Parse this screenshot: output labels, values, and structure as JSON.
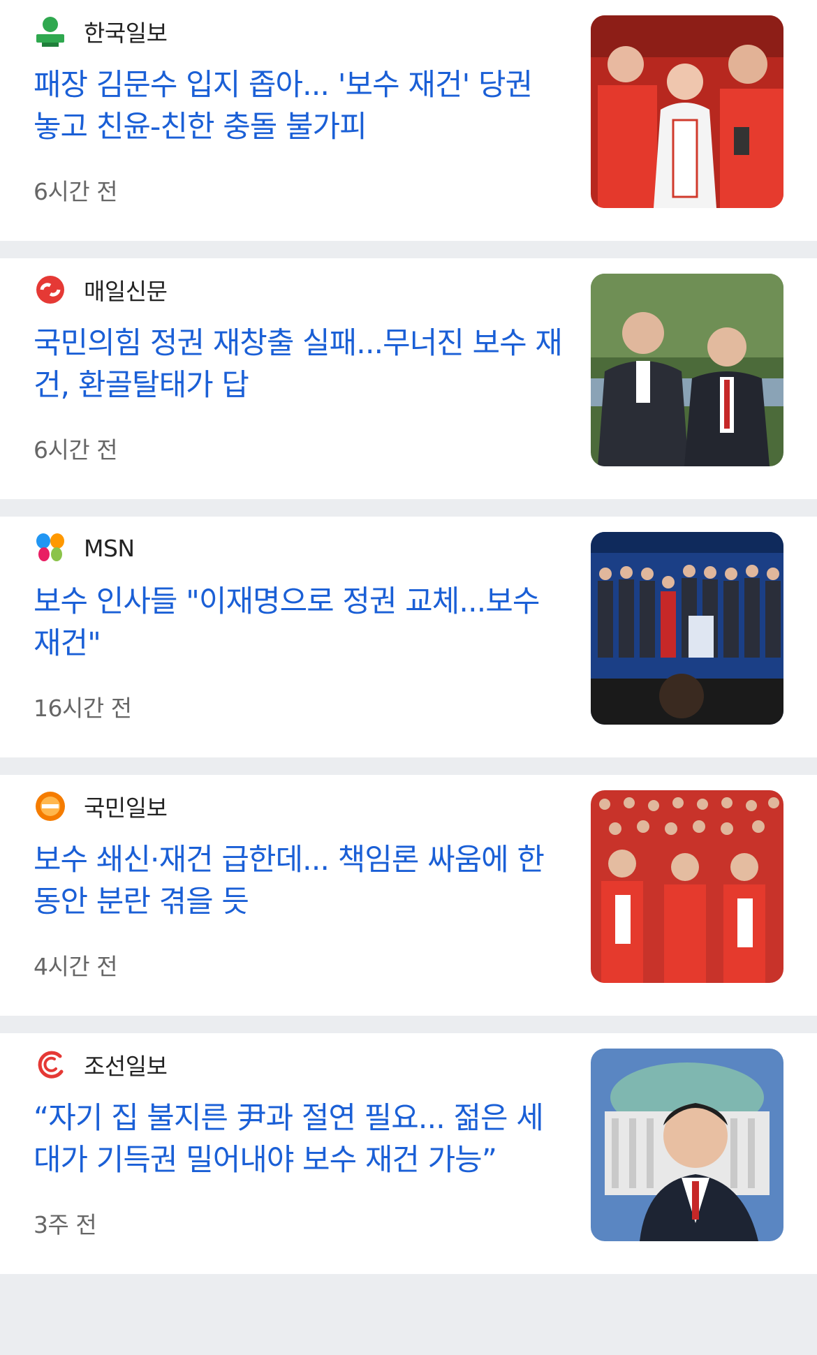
{
  "articles": [
    {
      "source": "한국일보",
      "logo_icon": "hankook-ilbo-logo-icon",
      "headline": "패장 김문수 입지 좁아... '보수 재건' 당권 놓고 친윤-친한 충돌 불가피",
      "time": "6시간 전",
      "thumbnail": "party-members-red-jackets-photo"
    },
    {
      "source": "매일신문",
      "logo_icon": "maeil-sinmun-logo-icon",
      "headline": "국민의힘 정권 재창출 실패...무너진 보수 재건, 환골탈태가 답",
      "time": "6시간 전",
      "thumbnail": "two-politicians-talking-photo"
    },
    {
      "source": "MSN",
      "logo_icon": "msn-butterfly-logo-icon",
      "headline": "보수 인사들 \"이재명으로 정권 교체...보수 재건\"",
      "time": "16시간 전",
      "thumbnail": "press-conference-stage-photo"
    },
    {
      "source": "국민일보",
      "logo_icon": "kukmin-ilbo-logo-icon",
      "headline": "보수 쇄신·재건 급한데... 책임론 싸움에 한동안 분란 겪을 듯",
      "time": "4시간 전",
      "thumbnail": "election-night-crowd-photo"
    },
    {
      "source": "조선일보",
      "logo_icon": "chosun-ilbo-logo-icon",
      "headline": "“자기 집 불지른 尹과 절연 필요... 젊은 세대가 기득권 밀어내야 보수 재건 가능”",
      "time": "3주 전",
      "thumbnail": "young-politician-portrait-photo"
    }
  ],
  "colors": {
    "headline": "#1a5fd6",
    "source": "#222222",
    "time": "#666666",
    "divider": "#ebedf0"
  }
}
